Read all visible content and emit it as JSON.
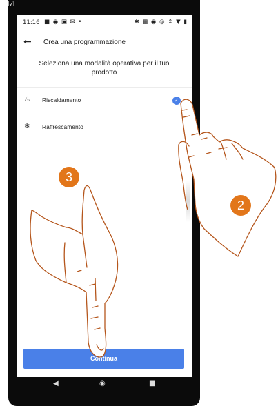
{
  "status_bar": {
    "time": "11:16",
    "left_icons": "■ ◉ ▣ ✉ •",
    "right_icons": "✱ ▦ ◉ ◎ ↕ ▼ ▮"
  },
  "corner_mark": "✕☑",
  "header": {
    "title": "Crea una programmazione",
    "back_icon": "arrow-left-icon"
  },
  "prompt": "Seleziona una modalità operativa per il tuo prodotto",
  "options": [
    {
      "label": "Riscaldamento",
      "icon": "♨",
      "selected": true
    },
    {
      "label": "Raffrescamento",
      "icon": "❄",
      "selected": false
    }
  ],
  "check_mark": "✓",
  "continue_label": "Continua",
  "nav": {
    "back": "◀",
    "home": "◉",
    "recents": "■"
  },
  "badges": {
    "step_2": "2",
    "step_3": "3"
  },
  "colors": {
    "accent": "#4a80e8",
    "badge": "#e2761a",
    "hand_outline": "#b5561c"
  }
}
